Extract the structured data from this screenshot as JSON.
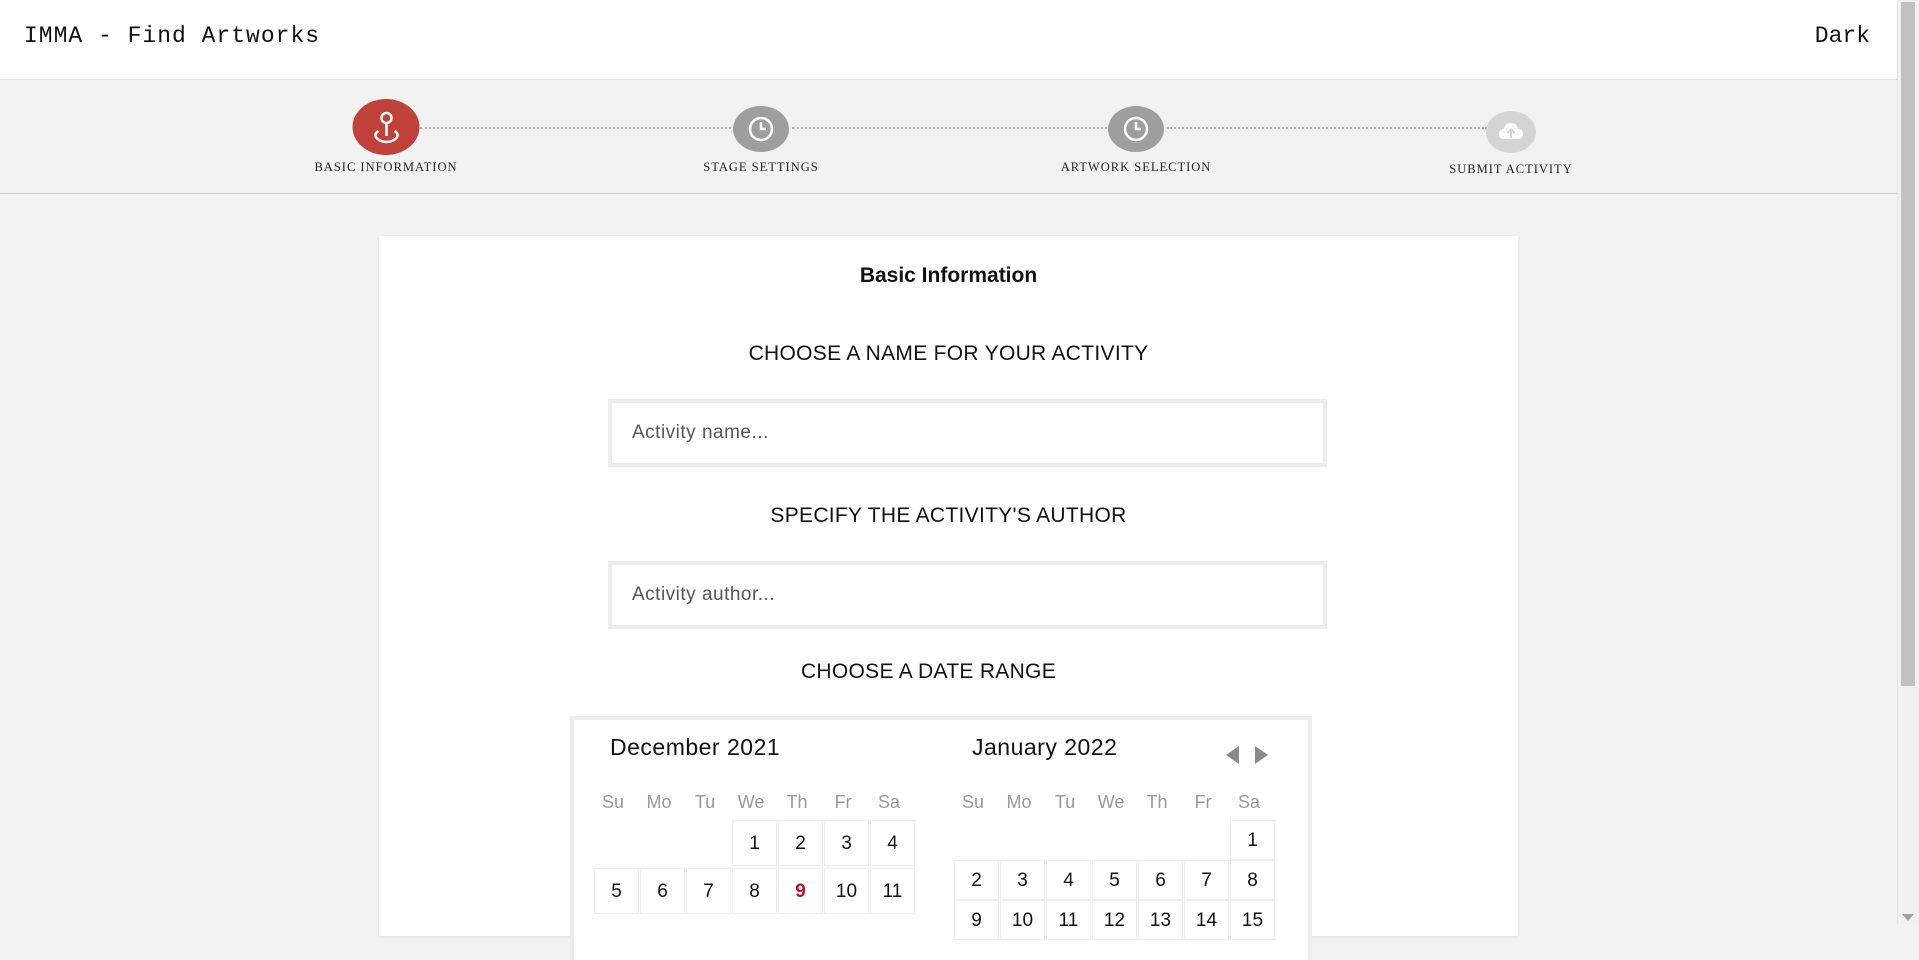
{
  "header": {
    "title": "IMMA - Find Artworks",
    "theme_toggle": "Dark"
  },
  "stepper": {
    "steps": [
      {
        "label": "BASIC INFORMATION",
        "icon": "location-pin-icon",
        "state": "active",
        "color": "#c0403a"
      },
      {
        "label": "STAGE SETTINGS",
        "icon": "clock-icon",
        "state": "pending",
        "color": "#9e9e9e"
      },
      {
        "label": "ARTWORK SELECTION",
        "icon": "clock-icon",
        "state": "pending",
        "color": "#9e9e9e"
      },
      {
        "label": "SUBMIT ACTIVITY",
        "icon": "cloud-upload-icon",
        "state": "disabled",
        "color": "#d4d4d4"
      }
    ]
  },
  "form": {
    "title": "Basic Information",
    "name_heading": "CHOOSE A NAME FOR YOUR ACTIVITY",
    "name_placeholder": "Activity name...",
    "author_heading": "SPECIFY THE ACTIVITY'S AUTHOR",
    "author_placeholder": "Activity author...",
    "date_heading": "CHOOSE A DATE RANGE"
  },
  "calendar": {
    "weekdays": [
      "Su",
      "Mo",
      "Tu",
      "We",
      "Th",
      "Fr",
      "Sa"
    ],
    "today_color": "#c0102a",
    "months": [
      {
        "title": "December 2021",
        "rows": [
          [
            "",
            "",
            "",
            "1",
            "2",
            "3",
            "4"
          ],
          [
            "5",
            "6",
            "7",
            "8",
            "9",
            "10",
            "11"
          ]
        ],
        "today": "9"
      },
      {
        "title": "January 2022",
        "rows": [
          [
            "",
            "",
            "",
            "",
            "",
            "",
            "1"
          ],
          [
            "2",
            "3",
            "4",
            "5",
            "6",
            "7",
            "8"
          ],
          [
            "9",
            "10",
            "11",
            "12",
            "13",
            "14",
            "15"
          ]
        ],
        "today": ""
      }
    ]
  }
}
